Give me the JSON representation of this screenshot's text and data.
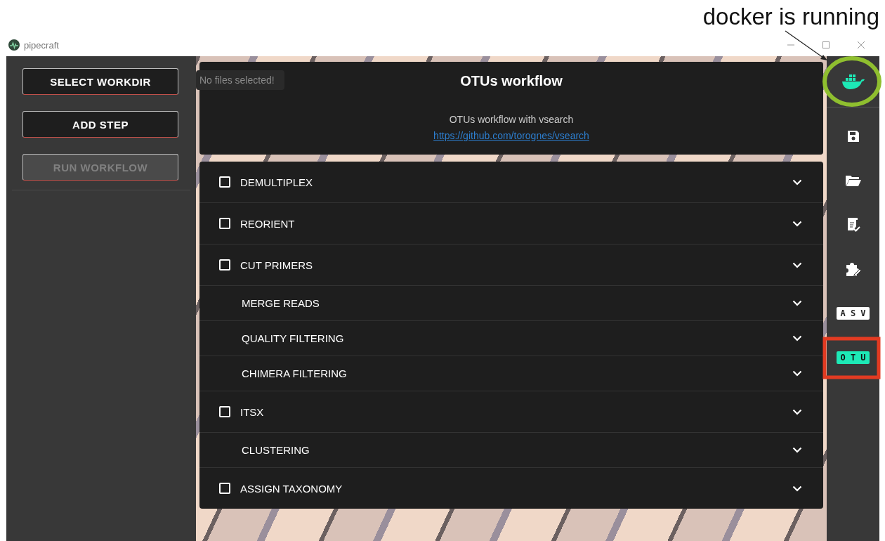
{
  "annotation": {
    "text": "docker is running"
  },
  "window": {
    "title": "pipecraft"
  },
  "sidebar": {
    "buttons": [
      {
        "label": "SELECT WORKDIR",
        "disabled": false
      },
      {
        "label": "ADD STEP",
        "disabled": false
      },
      {
        "label": "RUN WORKFLOW",
        "disabled": true
      }
    ]
  },
  "files_notice": "No files selected!",
  "workflow": {
    "title": "OTUs workflow",
    "description": "OTUs workflow with vsearch",
    "link": "https://github.com/torognes/vsearch"
  },
  "steps": [
    {
      "kind": "optional",
      "label": "DEMULTIPLEX",
      "checked": false
    },
    {
      "kind": "optional",
      "label": "REORIENT",
      "checked": false
    },
    {
      "kind": "optional",
      "label": "CUT PRIMERS",
      "checked": false
    },
    {
      "kind": "required",
      "label": "MERGE READS"
    },
    {
      "kind": "required",
      "label": "QUALITY FILTERING"
    },
    {
      "kind": "required",
      "label": "CHIMERA FILTERING"
    },
    {
      "kind": "optional",
      "label": "ITSX",
      "checked": false
    },
    {
      "kind": "required",
      "label": "CLUSTERING"
    },
    {
      "kind": "optional",
      "label": "ASSIGN TAXONOMY",
      "checked": false
    }
  ],
  "toolbar": {
    "docker_running": true,
    "workflows": [
      {
        "label": "A S V",
        "selected": false
      },
      {
        "label": "O T U",
        "selected": true
      }
    ]
  }
}
